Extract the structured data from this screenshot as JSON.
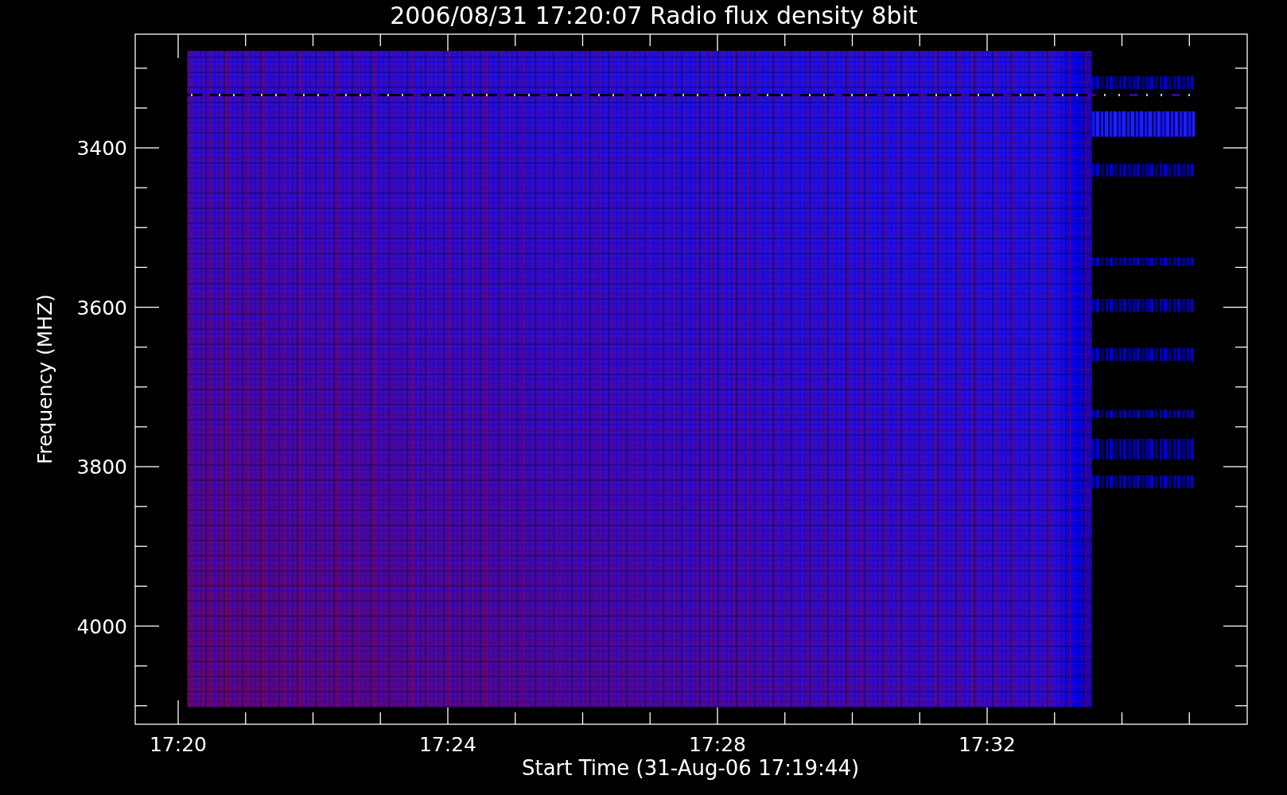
{
  "title": "2006/08/31 17:20:07 Radio flux density 8bit",
  "y_axis": {
    "label": "Frequency (MHZ)",
    "ticks": [
      "3400",
      "3600",
      "3800",
      "4000"
    ]
  },
  "x_axis": {
    "label": "Start Time (31-Aug-06 17:19:44)",
    "ticks": [
      "17:20",
      "17:24",
      "17:28",
      "17:32"
    ]
  }
}
